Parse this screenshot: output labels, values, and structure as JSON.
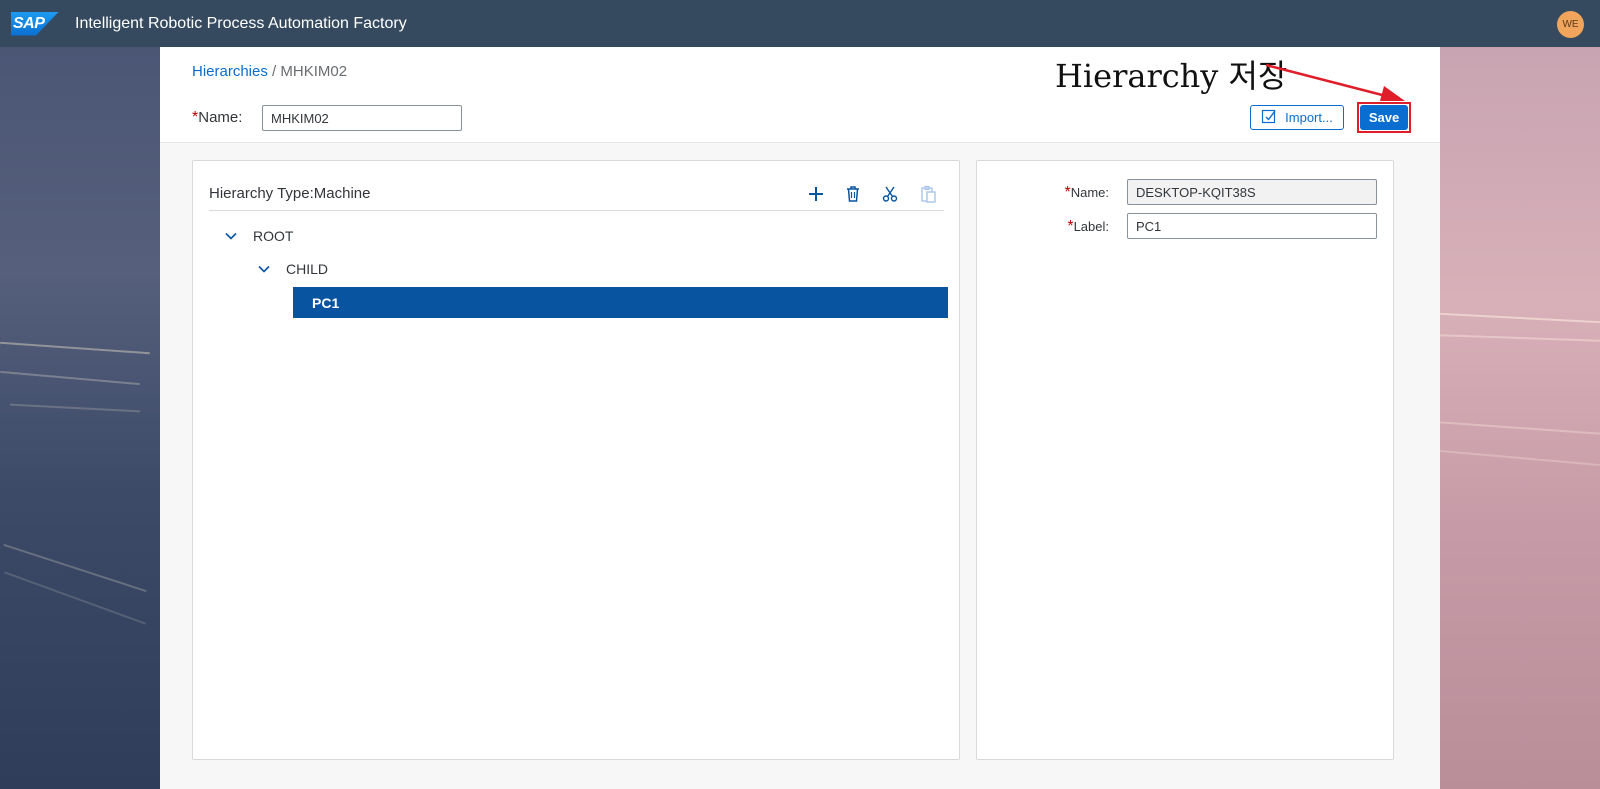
{
  "shellbar": {
    "logo_text": "SAP",
    "title": "Intelligent Robotic Process Automation Factory",
    "avatar_initials": "WE"
  },
  "breadcrumb": {
    "parent": "Hierarchies",
    "separator": " / ",
    "current": "MHKIM02"
  },
  "header": {
    "name_required_mark": "*",
    "name_label": "Name:",
    "name_value": "MHKIM02",
    "import_label": "Import...",
    "save_label": "Save"
  },
  "annotation": {
    "text": "Hierarchy 저장",
    "color": "#e01e2a"
  },
  "tree_panel": {
    "title": "Hierarchy Type:Machine",
    "toolbar_icons": [
      "add-icon",
      "delete-icon",
      "cut-icon",
      "paste-icon"
    ],
    "nodes": [
      {
        "label": "ROOT",
        "expanded": true
      },
      {
        "label": "CHILD",
        "expanded": true
      },
      {
        "label": "PC1",
        "selected": true
      }
    ]
  },
  "details_panel": {
    "fields": [
      {
        "required_mark": "*",
        "label": "Name:",
        "value": "DESKTOP-KQIT38S",
        "readonly": true
      },
      {
        "required_mark": "*",
        "label": "Label:",
        "value": "PC1",
        "readonly": false
      }
    ]
  },
  "colors": {
    "shellbar": "#354a5f",
    "accent": "#0a6ed1",
    "selection": "#0854a0",
    "required": "#bb0000"
  }
}
